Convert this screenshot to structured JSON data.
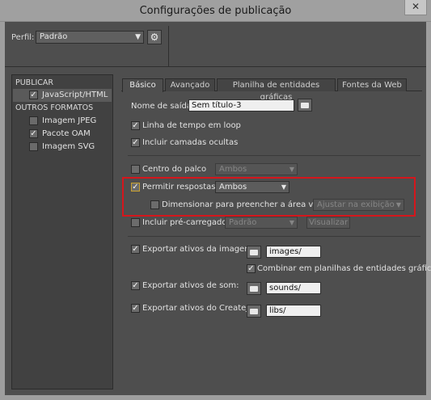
{
  "window": {
    "title": "Configurações de publicação",
    "close_glyph": "✕"
  },
  "profile": {
    "label": "Perfil:",
    "value": "Padrão",
    "gear_icon": "gear-icon"
  },
  "targets": {
    "publicar_header": "PUBLICAR",
    "publicar_items": [
      {
        "label": "JavaScript/HTML",
        "checked": true,
        "selected": true
      }
    ],
    "outros_header": "OUTROS FORMATOS",
    "outros_items": [
      {
        "label": "Imagem JPEG",
        "checked": false
      },
      {
        "label": "Pacote OAM",
        "checked": true
      },
      {
        "label": "Imagem SVG",
        "checked": false
      }
    ]
  },
  "tabs": [
    {
      "label": "Básico",
      "active": true
    },
    {
      "label": "Avançado",
      "active": false
    },
    {
      "label": "Planilha de entidades gráficas",
      "active": false
    },
    {
      "label": "Fontes da Web",
      "active": false
    }
  ],
  "basic": {
    "output_label": "Nome de saída:",
    "output_value": "Sem título-3",
    "loop_label": "Linha de tempo em loop",
    "loop_checked": true,
    "hidden_layers_label": "Incluir camadas ocultas",
    "hidden_layers_checked": true,
    "center_label": "Centro do palco",
    "center_checked": false,
    "center_value": "Ambos",
    "responsive_label": "Permitir respostas",
    "responsive_checked": true,
    "responsive_value": "Ambos",
    "scale_label": "Dimensionar para preencher a área visível",
    "scale_checked": false,
    "scale_value": "Ajustar na exibição",
    "preloader_label": "Incluir pré-carregador",
    "preloader_checked": false,
    "preloader_value": "Padrão",
    "preloader_button": "Visualizar",
    "image_assets_label": "Exportar ativos da imagem:",
    "image_assets_checked": true,
    "image_assets_path": "images/",
    "combine_label": "Combinar em planilhas de entidades gráficas",
    "combine_checked": true,
    "sound_assets_label": "Exportar ativos de som:",
    "sound_assets_checked": true,
    "sound_assets_path": "sounds/",
    "createjs_assets_label": "Exportar ativos do CreateJS:",
    "createjs_assets_checked": true,
    "createjs_assets_path": "libs/"
  },
  "colors": {
    "highlight": "#d5161c",
    "panel": "#4e4e4e",
    "frame": "#9e9e9e"
  }
}
